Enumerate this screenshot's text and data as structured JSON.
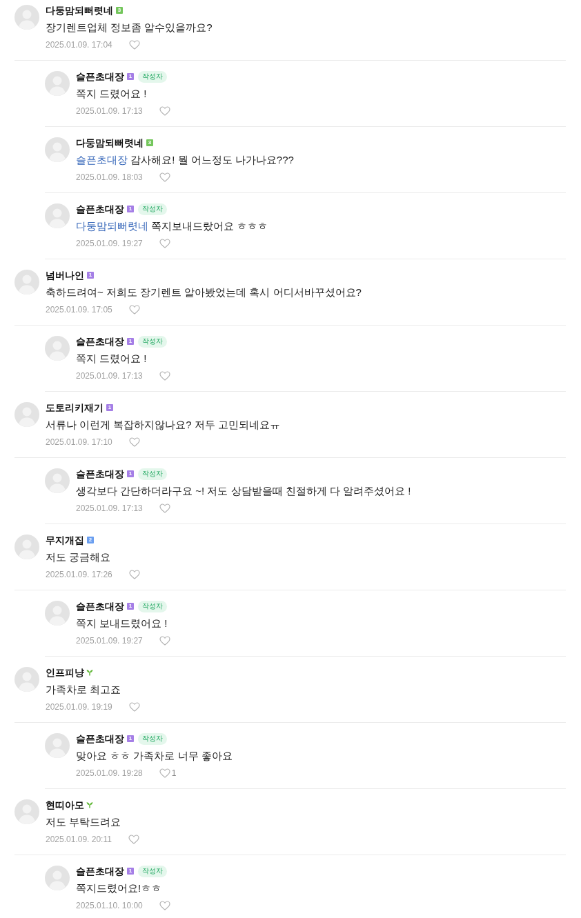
{
  "comments": [
    {
      "author": "다둥맘되뻐렷네",
      "badge": {
        "kind": "level",
        "label": "3",
        "color": "#74c65c"
      },
      "text": "장기렌트업체 정보좀 알수있을까요?",
      "date": "2025.01.09. 17:04",
      "replies": [
        {
          "author": "슬픈초대장",
          "badge": {
            "kind": "level",
            "label": "1",
            "color": "#a57fe6"
          },
          "author_tag": "작성자",
          "text": "쪽지 드렸어요 !",
          "date": "2025.01.09. 17:13"
        },
        {
          "author": "다둥맘되뻐렷네",
          "badge": {
            "kind": "level",
            "label": "3",
            "color": "#74c65c"
          },
          "mention": "슬픈초대장",
          "text": "감사해요! 뭘 어느정도 나가나요???",
          "date": "2025.01.09. 18:03"
        },
        {
          "author": "슬픈초대장",
          "badge": {
            "kind": "level",
            "label": "1",
            "color": "#a57fe6"
          },
          "author_tag": "작성자",
          "mention": "다둥맘되뻐렷네",
          "text": "쪽지보내드랐어요 ㅎㅎㅎ",
          "date": "2025.01.09. 19:27"
        }
      ]
    },
    {
      "author": "넘버나인",
      "badge": {
        "kind": "level",
        "label": "1",
        "color": "#a57fe6"
      },
      "text": "축하드려여~ 저희도 장기렌트 알아봤었는데 혹시 어디서바꾸셨어요?",
      "date": "2025.01.09. 17:05",
      "replies": [
        {
          "author": "슬픈초대장",
          "badge": {
            "kind": "level",
            "label": "1",
            "color": "#a57fe6"
          },
          "author_tag": "작성자",
          "text": "쪽지 드렸어요 !",
          "date": "2025.01.09. 17:13"
        }
      ]
    },
    {
      "author": "도토리키재기",
      "badge": {
        "kind": "level",
        "label": "1",
        "color": "#a57fe6"
      },
      "text": "서류나 이런게 복잡하지않나요? 저두 고민되네요ㅠ",
      "date": "2025.01.09. 17:10",
      "replies": [
        {
          "author": "슬픈초대장",
          "badge": {
            "kind": "level",
            "label": "1",
            "color": "#a57fe6"
          },
          "author_tag": "작성자",
          "text": "생각보다 간단하더라구요 ~! 저도 상담받을때 친절하게 다 알려주셨어요 !",
          "date": "2025.01.09. 17:13"
        }
      ]
    },
    {
      "author": "무지개집",
      "badge": {
        "kind": "level",
        "label": "2",
        "color": "#6b9ff0"
      },
      "text": "저도 궁금해요",
      "date": "2025.01.09. 17:26",
      "replies": [
        {
          "author": "슬픈초대장",
          "badge": {
            "kind": "level",
            "label": "1",
            "color": "#a57fe6"
          },
          "author_tag": "작성자",
          "text": "쪽지 보내드렸어요 !",
          "date": "2025.01.09. 19:27"
        }
      ]
    },
    {
      "author": "인프피냥",
      "badge": {
        "kind": "sprout"
      },
      "text": "가족차로 최고죠",
      "date": "2025.01.09. 19:19",
      "replies": [
        {
          "author": "슬픈초대장",
          "badge": {
            "kind": "level",
            "label": "1",
            "color": "#a57fe6"
          },
          "author_tag": "작성자",
          "text": "맞아요 ㅎㅎ 가족차로 너무 좋아요",
          "date": "2025.01.09. 19:28",
          "likes": "1"
        }
      ]
    },
    {
      "author": "현띠아모",
      "badge": {
        "kind": "sprout"
      },
      "text": "저도 부탁드려요",
      "date": "2025.01.09. 20:11",
      "replies": [
        {
          "author": "슬픈초대장",
          "badge": {
            "kind": "level",
            "label": "1",
            "color": "#a57fe6"
          },
          "author_tag": "작성자",
          "text": "쪽지드렸어요!ㅎㅎ",
          "date": "2025.01.10. 10:00"
        }
      ]
    }
  ]
}
